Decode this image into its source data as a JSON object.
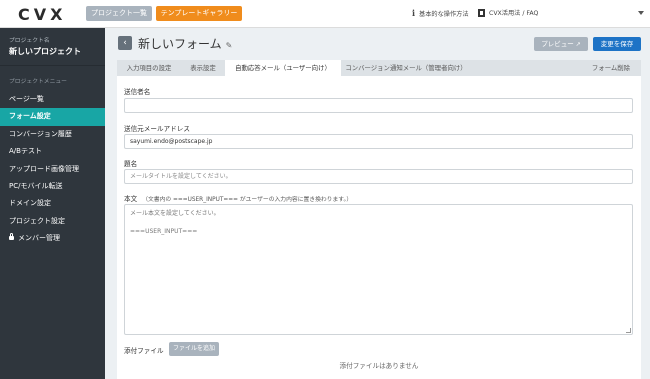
{
  "header": {
    "logo": "CVX",
    "projects_button": "プロジェクト一覧",
    "gallery_button": "テンプレートギャラリー",
    "help_link": "基本的な操作方法",
    "faq_link": "CVX活用法 / FAQ"
  },
  "sidebar": {
    "project_label": "プロジェクト名",
    "project_name": "新しいプロジェクト",
    "menu_label": "プロジェクトメニュー",
    "items": [
      {
        "label": "ページ一覧"
      },
      {
        "label": "フォーム設定"
      },
      {
        "label": "コンバージョン履歴"
      },
      {
        "label": "A/Bテスト"
      },
      {
        "label": "アップロード画像管理"
      },
      {
        "label": "PC/モバイル転送"
      },
      {
        "label": "ドメイン設定"
      },
      {
        "label": "プロジェクト設定"
      },
      {
        "label": "メンバー管理"
      }
    ]
  },
  "main": {
    "title": "新しいフォーム",
    "preview_button": "プレビュー",
    "save_button": "変更を保存",
    "tabs": [
      {
        "label": "入力項目の設定"
      },
      {
        "label": "表示設定"
      },
      {
        "label": "自動応答メール（ユーザー向け）"
      },
      {
        "label": "コンバージョン通知メール（管理者向け）"
      },
      {
        "label": "フォーム削除"
      }
    ],
    "fields": {
      "sender_name_label": "送信者名",
      "sender_name_value": "",
      "sender_email_label": "送信元メールアドレス",
      "sender_email_value": "sayumi.endo@postscape.jp",
      "subject_label": "題名",
      "subject_placeholder": "メールタイトルを設定してください。",
      "body_label": "本文",
      "body_note": "（文書内の ===USER_INPUT=== がユーザーの入力内容に置き換わります。）",
      "body_line1": "メール本文を設定してください。",
      "body_line2": "===USER_INPUT===",
      "attachment_label": "添付ファイル",
      "attachment_button": "ファイルを追加",
      "no_attachment": "添付ファイルはありません"
    }
  }
}
